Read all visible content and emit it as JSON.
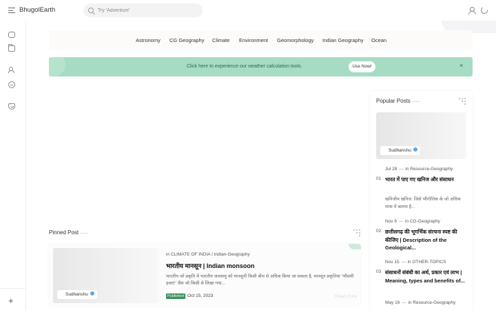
{
  "header": {
    "brand": "BhugolEarth",
    "search_placeholder": "Try 'Adventure'"
  },
  "categories": [
    "Astronomy",
    "CG Geography",
    "Climate",
    "Environment",
    "Geomorphology",
    "Indian Geography",
    "Ocean"
  ],
  "banner": {
    "text": "Click here to experience our weather calculation tools.",
    "button": "Use Now!",
    "close": "×"
  },
  "pinned": {
    "section_title": "Pinned Post",
    "author": "Sudhanshu",
    "category_prefix": "in",
    "category": "CLIMATE OF INDIA / Indian-Geography",
    "title": "भारतीय मानसून | Indian monsoon",
    "description": "भारतीय जो प्रकृति में भारतीय जलवायु को मानसूनी किसी बीच से अधिक किया जा सकता है, मानसून प्रकृतिया \"मौसमी हवाएं\" जैस जो किसी से लिखा गया...",
    "status": "Published",
    "date": "Oct 15, 2023",
    "read_more": "Read more"
  },
  "popular": {
    "section_title": "Popular Posts",
    "author": "Sudhanshu",
    "items": [
      {
        "num": "01",
        "date": "Jul 28",
        "prefix": "in",
        "category": "Resource-Geography",
        "title": "भारत में पाए गए खनिज और संसाधन",
        "desc": "खनिजीय खनिज: जिसे भौगोलिक के जो अधिक मात्रा में बताया है..."
      },
      {
        "num": "02",
        "date": "Nov 6",
        "prefix": "in",
        "category": "CG-Geography",
        "title": "छत्तीसगढ़ की भूगर्भिक संरचना स्पष्ट की कीजिए | Description of the Geological...",
        "desc": ""
      },
      {
        "num": "03",
        "date": "Nov 15",
        "prefix": "in",
        "category": "OTHER-TOPICS",
        "title": "संसाधनों संबंधी का अर्थ, प्रकार एवं लाभ | Meaning, types and benefits of...",
        "desc": ""
      },
      {
        "num": "",
        "date": "May 16",
        "prefix": "in",
        "category": "Resource-Geography",
        "title": "",
        "desc": ""
      }
    ]
  }
}
